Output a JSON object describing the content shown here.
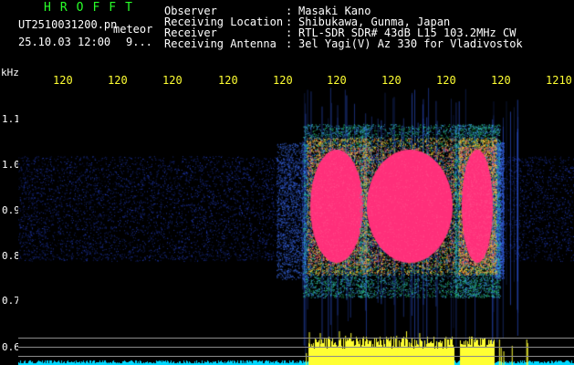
{
  "brand": "HROFFT",
  "file": {
    "name": "UT2510031200.pn",
    "tag": "meteor",
    "time": "25.10.03 12:00",
    "frame": "9..."
  },
  "info": [
    {
      "label": "Observer",
      "sep": ":",
      "value": "Masaki Kano"
    },
    {
      "label": "Receiving Location",
      "sep": ":",
      "value": "Shibukawa, Gunma, Japan"
    },
    {
      "label": "Receiver",
      "sep": ":",
      "value": "RTL-SDR SDR# 43dB L15 103.2MHz CW"
    },
    {
      "label": "Receiving Antenna",
      "sep": ":",
      "value": "3el Yagi(V) Az 330 for Vladivostok"
    }
  ],
  "axis": {
    "y_unit": "kHz",
    "y_ticks": [
      "1.1",
      "1.0",
      "0.9",
      "0.8",
      "0.7",
      "0.6"
    ],
    "x_ticks": [
      "120",
      "120",
      "120",
      "120",
      "120",
      "120",
      "120",
      "120",
      "120",
      "1210"
    ]
  },
  "colors": {
    "background": "#000000",
    "noise": "#1f3fd8",
    "signal_hot": "#ff2f7a",
    "signal_warm": "#ffff33",
    "baseline": "#00d8ff",
    "header_text": "#ffffff",
    "brand_text": "#29ff29",
    "tick_text": "#ffff33"
  }
}
